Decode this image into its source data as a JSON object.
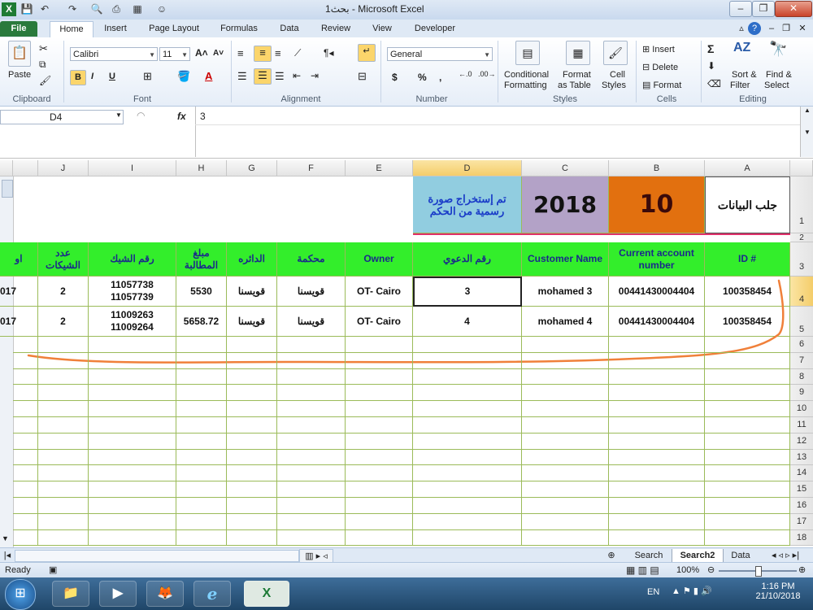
{
  "window": {
    "title": "بحث1 - Microsoft Excel",
    "minimize_icon": "minimize-icon",
    "maximize_icon": "maximize-icon",
    "close_icon": "close-icon"
  },
  "ribbon": {
    "tabs": [
      {
        "label": "File"
      },
      {
        "label": "Home"
      },
      {
        "label": "Insert"
      },
      {
        "label": "Page Layout"
      },
      {
        "label": "Formulas"
      },
      {
        "label": "Data"
      },
      {
        "label": "Review"
      },
      {
        "label": "View"
      },
      {
        "label": "Developer"
      }
    ],
    "clipboard": {
      "paste": "Paste",
      "group": "Clipboard"
    },
    "font": {
      "name": "Calibri",
      "size": "11",
      "bold": "B",
      "italic": "I",
      "underline": "U",
      "group": "Font"
    },
    "alignment": {
      "group": "Alignment"
    },
    "number": {
      "format": "General",
      "currency": "$",
      "percent": "%",
      "comma": ",",
      "group": "Number"
    },
    "styles": {
      "conditional": "Conditional",
      "conditional2": "Formatting",
      "format_table": "Format",
      "format_table2": "as Table",
      "cell": "Cell",
      "cell2": "Styles",
      "group": "Styles"
    },
    "cells": {
      "insert": "Insert",
      "delete": "Delete",
      "format": "Format",
      "group": "Cells"
    },
    "editing": {
      "sum": "Σ",
      "sort": "Sort &",
      "sort2": "Filter",
      "find": "Find &",
      "find2": "Select",
      "group": "Editing"
    }
  },
  "formula_bar": {
    "name_box": "D4",
    "fx": "fx",
    "value": "3"
  },
  "columns": [
    "J",
    "I",
    "H",
    "G",
    "F",
    "E",
    "D",
    "C",
    "B",
    "A"
  ],
  "rows": [
    "1",
    "2",
    "3",
    "4",
    "5",
    "6",
    "7",
    "8",
    "9",
    "10",
    "11",
    "12",
    "13",
    "14",
    "15",
    "16",
    "17",
    "18"
  ],
  "row1": {
    "D": "تم إستخراج صورة رسمية من الحكم",
    "C": "2018",
    "B": "10",
    "A": "جلب البيانات"
  },
  "headers": {
    "K": "او",
    "J": "عدد الشيكات",
    "I": "رقم الشيك",
    "H": "مبلغ المطالبة",
    "G": "الدائره",
    "F": "محكمة",
    "E": "Owner",
    "D": "رقم الدعوي",
    "C": "Customer Name",
    "B": "Current account number",
    "A": "ID #"
  },
  "data_rows": [
    {
      "K": "017",
      "J": "2",
      "I1": "11057738",
      "I2": "11057739",
      "H": "5530",
      "G": "قويسنا",
      "F": "قويسنا",
      "E": "OT- Cairo",
      "D": "3",
      "C": "mohamed 3",
      "B": "00441430004404",
      "A": "100358454"
    },
    {
      "K": "017",
      "J": "2",
      "I1": "11009263",
      "I2": "11009264",
      "H": "5658.72",
      "G": "قويسنا",
      "F": "قويسنا",
      "E": "OT- Cairo",
      "D": "4",
      "C": "mohamed 4",
      "B": "00441430004404",
      "A": "100358454"
    }
  ],
  "sheets": [
    {
      "label": "Search"
    },
    {
      "label": "Search2"
    },
    {
      "label": "Data"
    }
  ],
  "status": {
    "ready": "Ready",
    "zoom": "100%"
  },
  "taskbar": {
    "lang": "EN",
    "time": "1:16 PM",
    "date": "21/10/2018"
  },
  "colors": {
    "header_green": "#33ee2b",
    "b1_orange": "#e2700f",
    "c1_purple": "#b3a2c7",
    "d1_blue": "#91cde0",
    "annotation": "#f0803a"
  }
}
